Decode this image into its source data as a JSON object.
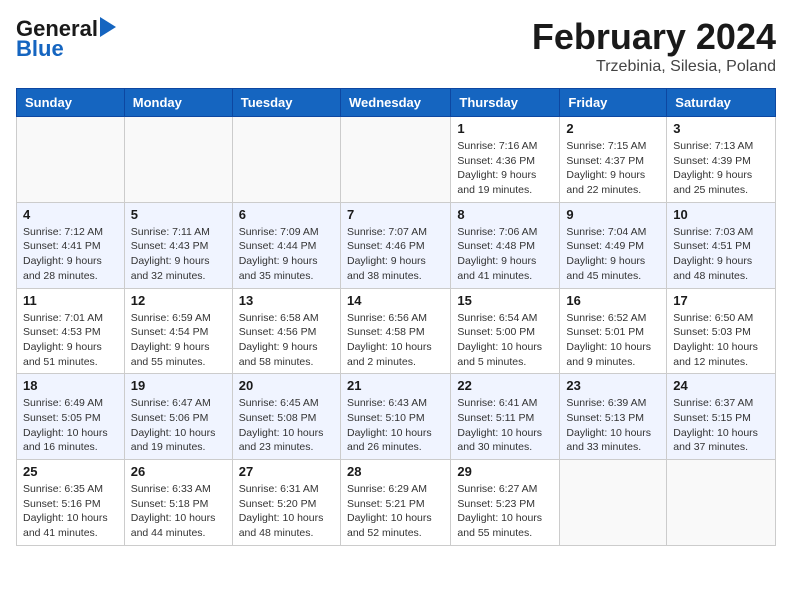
{
  "header": {
    "logo_general": "General",
    "logo_blue": "Blue",
    "month": "February 2024",
    "location": "Trzebinia, Silesia, Poland"
  },
  "weekdays": [
    "Sunday",
    "Monday",
    "Tuesday",
    "Wednesday",
    "Thursday",
    "Friday",
    "Saturday"
  ],
  "weeks": [
    [
      {
        "day": "",
        "info": ""
      },
      {
        "day": "",
        "info": ""
      },
      {
        "day": "",
        "info": ""
      },
      {
        "day": "",
        "info": ""
      },
      {
        "day": "1",
        "info": "Sunrise: 7:16 AM\nSunset: 4:36 PM\nDaylight: 9 hours\nand 19 minutes."
      },
      {
        "day": "2",
        "info": "Sunrise: 7:15 AM\nSunset: 4:37 PM\nDaylight: 9 hours\nand 22 minutes."
      },
      {
        "day": "3",
        "info": "Sunrise: 7:13 AM\nSunset: 4:39 PM\nDaylight: 9 hours\nand 25 minutes."
      }
    ],
    [
      {
        "day": "4",
        "info": "Sunrise: 7:12 AM\nSunset: 4:41 PM\nDaylight: 9 hours\nand 28 minutes."
      },
      {
        "day": "5",
        "info": "Sunrise: 7:11 AM\nSunset: 4:43 PM\nDaylight: 9 hours\nand 32 minutes."
      },
      {
        "day": "6",
        "info": "Sunrise: 7:09 AM\nSunset: 4:44 PM\nDaylight: 9 hours\nand 35 minutes."
      },
      {
        "day": "7",
        "info": "Sunrise: 7:07 AM\nSunset: 4:46 PM\nDaylight: 9 hours\nand 38 minutes."
      },
      {
        "day": "8",
        "info": "Sunrise: 7:06 AM\nSunset: 4:48 PM\nDaylight: 9 hours\nand 41 minutes."
      },
      {
        "day": "9",
        "info": "Sunrise: 7:04 AM\nSunset: 4:49 PM\nDaylight: 9 hours\nand 45 minutes."
      },
      {
        "day": "10",
        "info": "Sunrise: 7:03 AM\nSunset: 4:51 PM\nDaylight: 9 hours\nand 48 minutes."
      }
    ],
    [
      {
        "day": "11",
        "info": "Sunrise: 7:01 AM\nSunset: 4:53 PM\nDaylight: 9 hours\nand 51 minutes."
      },
      {
        "day": "12",
        "info": "Sunrise: 6:59 AM\nSunset: 4:54 PM\nDaylight: 9 hours\nand 55 minutes."
      },
      {
        "day": "13",
        "info": "Sunrise: 6:58 AM\nSunset: 4:56 PM\nDaylight: 9 hours\nand 58 minutes."
      },
      {
        "day": "14",
        "info": "Sunrise: 6:56 AM\nSunset: 4:58 PM\nDaylight: 10 hours\nand 2 minutes."
      },
      {
        "day": "15",
        "info": "Sunrise: 6:54 AM\nSunset: 5:00 PM\nDaylight: 10 hours\nand 5 minutes."
      },
      {
        "day": "16",
        "info": "Sunrise: 6:52 AM\nSunset: 5:01 PM\nDaylight: 10 hours\nand 9 minutes."
      },
      {
        "day": "17",
        "info": "Sunrise: 6:50 AM\nSunset: 5:03 PM\nDaylight: 10 hours\nand 12 minutes."
      }
    ],
    [
      {
        "day": "18",
        "info": "Sunrise: 6:49 AM\nSunset: 5:05 PM\nDaylight: 10 hours\nand 16 minutes."
      },
      {
        "day": "19",
        "info": "Sunrise: 6:47 AM\nSunset: 5:06 PM\nDaylight: 10 hours\nand 19 minutes."
      },
      {
        "day": "20",
        "info": "Sunrise: 6:45 AM\nSunset: 5:08 PM\nDaylight: 10 hours\nand 23 minutes."
      },
      {
        "day": "21",
        "info": "Sunrise: 6:43 AM\nSunset: 5:10 PM\nDaylight: 10 hours\nand 26 minutes."
      },
      {
        "day": "22",
        "info": "Sunrise: 6:41 AM\nSunset: 5:11 PM\nDaylight: 10 hours\nand 30 minutes."
      },
      {
        "day": "23",
        "info": "Sunrise: 6:39 AM\nSunset: 5:13 PM\nDaylight: 10 hours\nand 33 minutes."
      },
      {
        "day": "24",
        "info": "Sunrise: 6:37 AM\nSunset: 5:15 PM\nDaylight: 10 hours\nand 37 minutes."
      }
    ],
    [
      {
        "day": "25",
        "info": "Sunrise: 6:35 AM\nSunset: 5:16 PM\nDaylight: 10 hours\nand 41 minutes."
      },
      {
        "day": "26",
        "info": "Sunrise: 6:33 AM\nSunset: 5:18 PM\nDaylight: 10 hours\nand 44 minutes."
      },
      {
        "day": "27",
        "info": "Sunrise: 6:31 AM\nSunset: 5:20 PM\nDaylight: 10 hours\nand 48 minutes."
      },
      {
        "day": "28",
        "info": "Sunrise: 6:29 AM\nSunset: 5:21 PM\nDaylight: 10 hours\nand 52 minutes."
      },
      {
        "day": "29",
        "info": "Sunrise: 6:27 AM\nSunset: 5:23 PM\nDaylight: 10 hours\nand 55 minutes."
      },
      {
        "day": "",
        "info": ""
      },
      {
        "day": "",
        "info": ""
      }
    ]
  ]
}
